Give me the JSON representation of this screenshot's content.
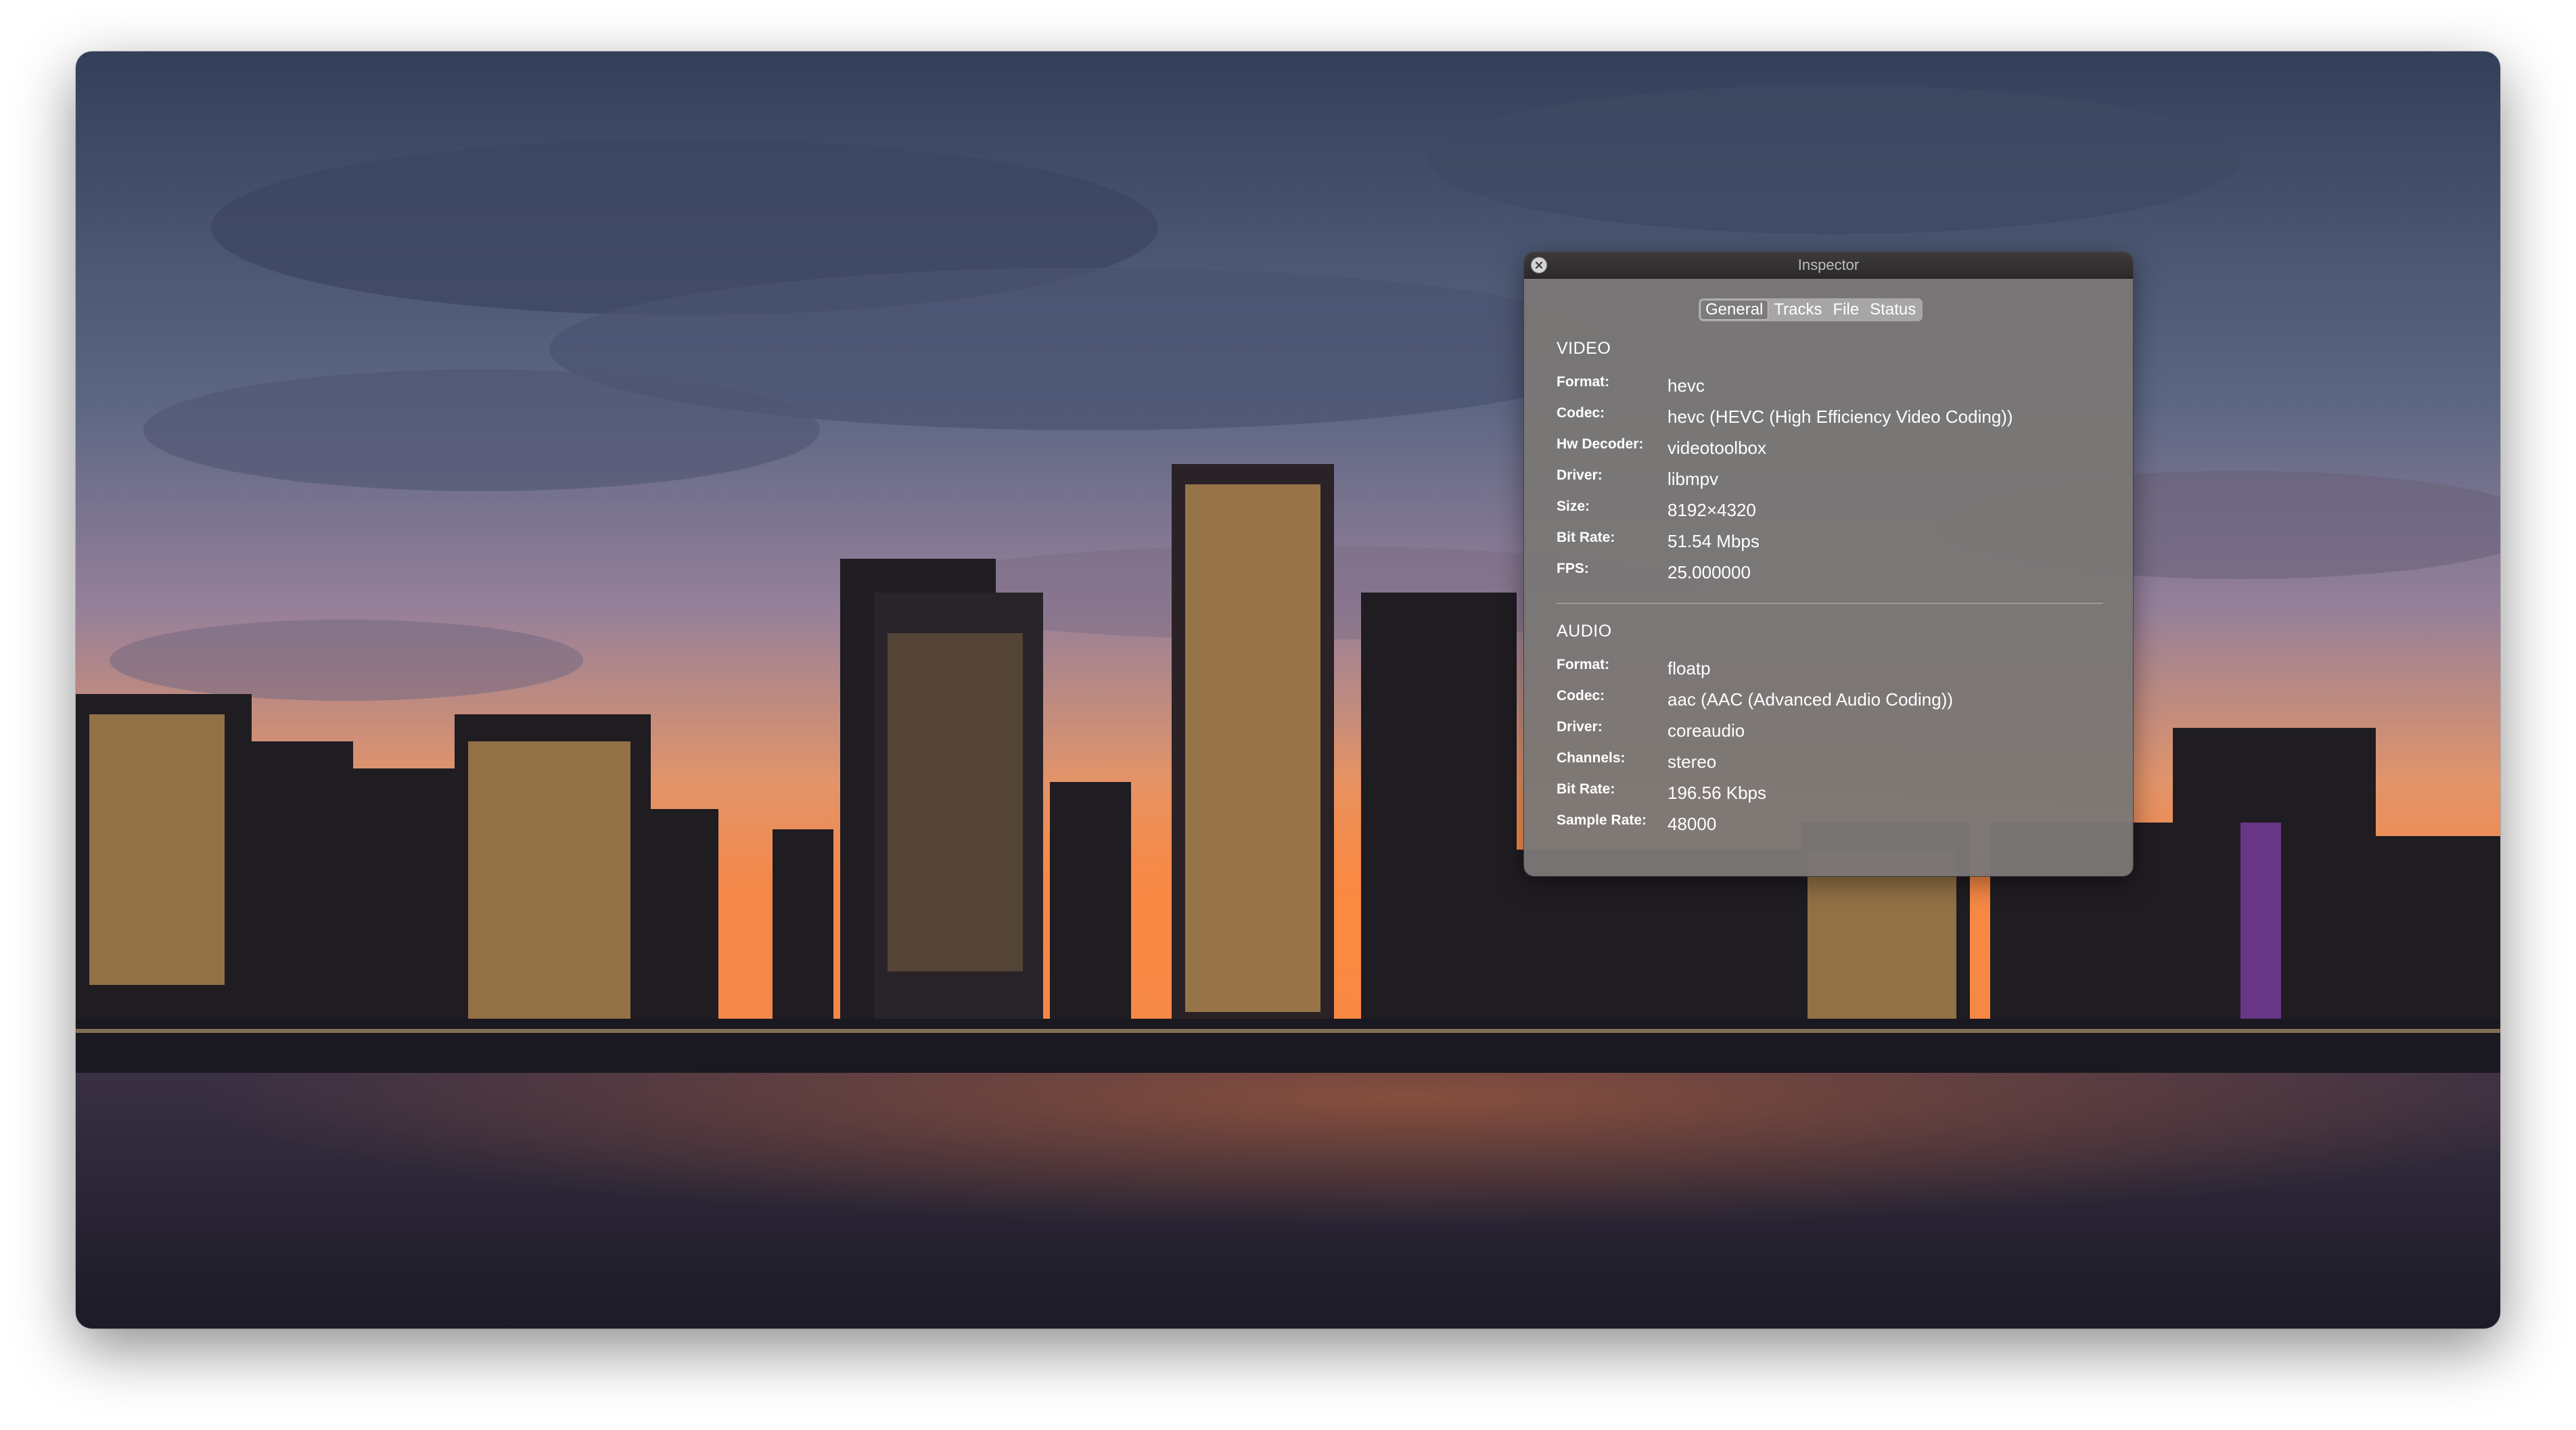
{
  "inspector": {
    "title": "Inspector",
    "tabs": [
      {
        "label": "General",
        "active": true
      },
      {
        "label": "Tracks",
        "active": false
      },
      {
        "label": "File",
        "active": false
      },
      {
        "label": "Status",
        "active": false
      }
    ],
    "video": {
      "heading": "VIDEO",
      "format_label": "Format:",
      "format": "hevc",
      "codec_label": "Codec:",
      "codec": "hevc (HEVC (High Efficiency Video Coding))",
      "hwdec_label": "Hw Decoder:",
      "hwdec": "videotoolbox",
      "driver_label": "Driver:",
      "driver": "libmpv",
      "size_label": "Size:",
      "size": "8192×4320",
      "bitrate_label": "Bit Rate:",
      "bitrate": "51.54 Mbps",
      "fps_label": "FPS:",
      "fps": "25.000000"
    },
    "audio": {
      "heading": "AUDIO",
      "format_label": "Format:",
      "format": "floatp",
      "codec_label": "Codec:",
      "codec": "aac (AAC (Advanced Audio Coding))",
      "driver_label": "Driver:",
      "driver": "coreaudio",
      "channels_label": "Channels:",
      "channels": "stereo",
      "bitrate_label": "Bit Rate:",
      "bitrate": "196.56 Kbps",
      "samplerate_label": "Sample Rate:",
      "samplerate": "48000"
    }
  },
  "colors": {
    "panel_background": "#7a7776",
    "titlebar": "#2f2d2e",
    "text": "#ffffff"
  }
}
